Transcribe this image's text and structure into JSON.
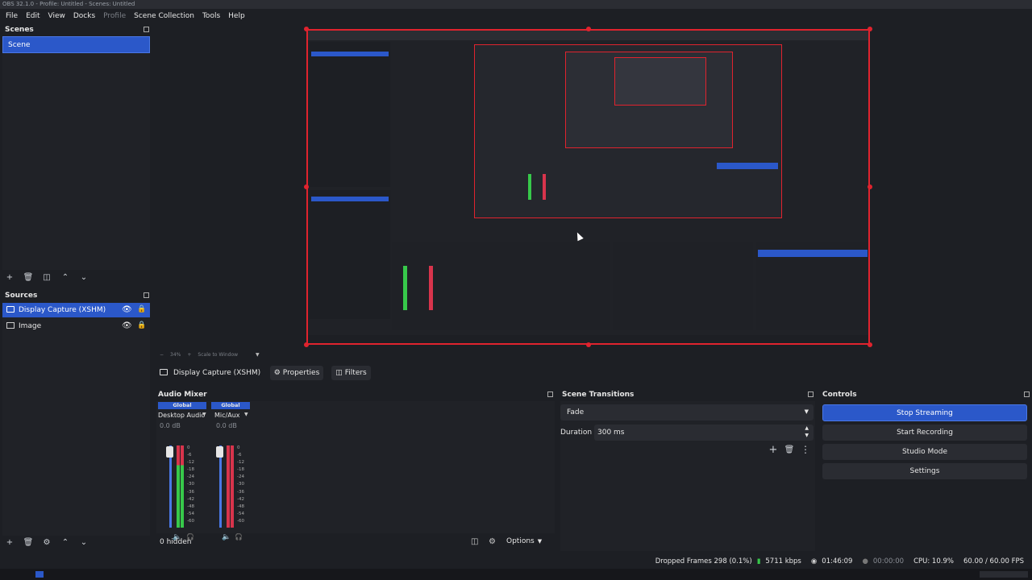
{
  "window": {
    "title": "OBS 32.1.0 - Profile: Untitled - Scenes: Untitled"
  },
  "menu": [
    "File",
    "Edit",
    "View",
    "Docks",
    "Profile",
    "Scene Collection",
    "Tools",
    "Help"
  ],
  "scenes": {
    "title": "Scenes",
    "items": [
      "Scene"
    ]
  },
  "sources": {
    "title": "Sources",
    "items": [
      {
        "name": "Display Capture (XSHM)"
      },
      {
        "name": "Image"
      }
    ]
  },
  "preview": {
    "zoom": "34%",
    "scale_label": "Scale to Window",
    "minus": "−",
    "plus": "+"
  },
  "source_toolbar": {
    "source_name": "Display Capture (XSHM)",
    "properties": "Properties",
    "filters": "Filters"
  },
  "audio_mixer": {
    "title": "Audio Mixer",
    "channels": [
      {
        "badge": "Global",
        "name": "Desktop Audio",
        "db": "0.0 dB"
      },
      {
        "badge": "Global",
        "name": "Mic/Aux",
        "db": "0.0 dB"
      }
    ],
    "scale": [
      "0",
      "-6",
      "-12",
      "-18",
      "-24",
      "-30",
      "-36",
      "-42",
      "-48",
      "-54",
      "-60"
    ],
    "hidden": "0 hidden",
    "options": "Options"
  },
  "transitions": {
    "title": "Scene Transitions",
    "selected": "Fade",
    "duration_label": "Duration",
    "duration_value": "300 ms"
  },
  "controls": {
    "title": "Controls",
    "stop_streaming": "Stop Streaming",
    "start_recording": "Start Recording",
    "studio_mode": "Studio Mode",
    "settings": "Settings"
  },
  "status": {
    "dropped": "Dropped Frames 298 (0.1%)",
    "bitrate": "5711 kbps",
    "stream_time": "01:46:09",
    "rec_time": "00:00:00",
    "cpu": "CPU: 10.9%",
    "fps": "60.00 / 60.00 FPS"
  },
  "colors": {
    "accent": "#2b58c9",
    "selection_outline": "#e0232e",
    "meter_green": "#37c84a",
    "meter_red": "#d8344c",
    "background": "#1d1f24"
  }
}
